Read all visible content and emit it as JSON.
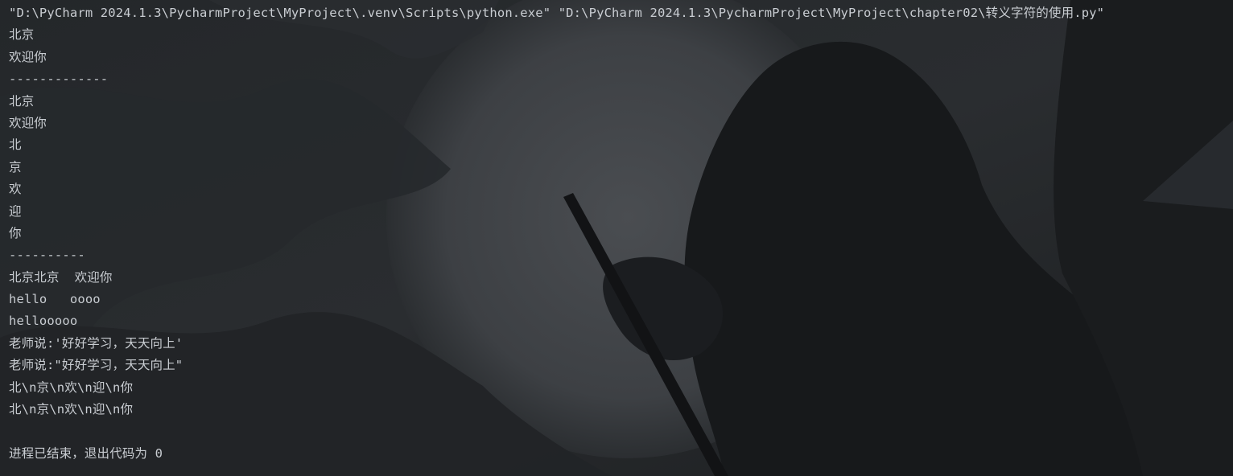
{
  "console": {
    "command": "\"D:\\PyCharm 2024.1.3\\PycharmProject\\MyProject\\.venv\\Scripts\\python.exe\" \"D:\\PyCharm 2024.1.3\\PycharmProject\\MyProject\\chapter02\\转义字符的使用.py\"",
    "output_lines": [
      "北京",
      "欢迎你",
      "-------------",
      "北京",
      "欢迎你",
      "北",
      "京",
      "欢",
      "迎",
      "你",
      "----------",
      "北京北京  欢迎你",
      "hello   oooo",
      "hellooooo",
      "老师说:'好好学习，天天向上'",
      "老师说:\"好好学习，天天向上\"",
      "北\\n京\\n欢\\n迎\\n你",
      "北\\n京\\n欢\\n迎\\n你",
      "",
      "进程已结束，退出代码为 0"
    ]
  },
  "theme": {
    "background": "#1e2022",
    "text_color": "#c9cdd2"
  }
}
